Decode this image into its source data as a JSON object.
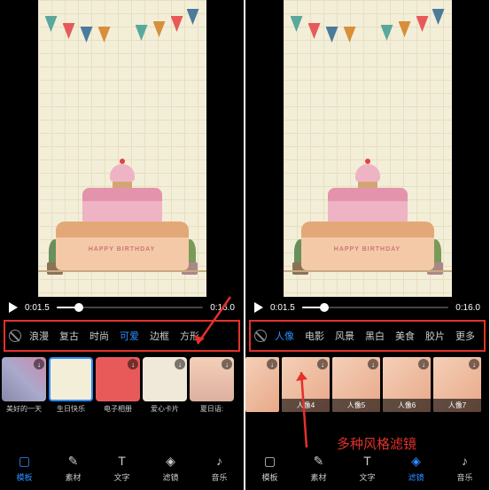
{
  "left": {
    "time_current": "0:01.5",
    "time_total": "0:16.0",
    "tabs": [
      "浪漫",
      "复古",
      "时尚",
      "可爱",
      "边框",
      "方形"
    ],
    "active_tab_index": 3,
    "thumbs": [
      {
        "label": "美好的一天"
      },
      {
        "label": "生日快乐"
      },
      {
        "label": "电子相册"
      },
      {
        "label": "爱心卡片"
      },
      {
        "label": "夏日语:"
      }
    ],
    "active_thumb_index": 1,
    "nav": [
      {
        "label": "模板",
        "icon": "▢"
      },
      {
        "label": "素材",
        "icon": "✎"
      },
      {
        "label": "文字",
        "icon": "T"
      },
      {
        "label": "滤镜",
        "icon": "◈"
      },
      {
        "label": "音乐",
        "icon": "♪"
      }
    ],
    "active_nav_index": 0
  },
  "right": {
    "time_current": "0:01.5",
    "time_total": "0:16.0",
    "tabs": [
      "人像",
      "电影",
      "风景",
      "黑白",
      "美食",
      "胶片",
      "更多"
    ],
    "active_tab_index": 0,
    "thumbs": [
      {
        "label": "人像4"
      },
      {
        "label": "人像5"
      },
      {
        "label": "人像6"
      },
      {
        "label": "人像7"
      }
    ],
    "nav": [
      {
        "label": "模板",
        "icon": "▢"
      },
      {
        "label": "素材",
        "icon": "✎"
      },
      {
        "label": "文字",
        "icon": "T"
      },
      {
        "label": "滤镜",
        "icon": "◈"
      },
      {
        "label": "音乐",
        "icon": "♪"
      }
    ],
    "active_nav_index": 3
  },
  "annotation_text": "多种风格滤镜"
}
